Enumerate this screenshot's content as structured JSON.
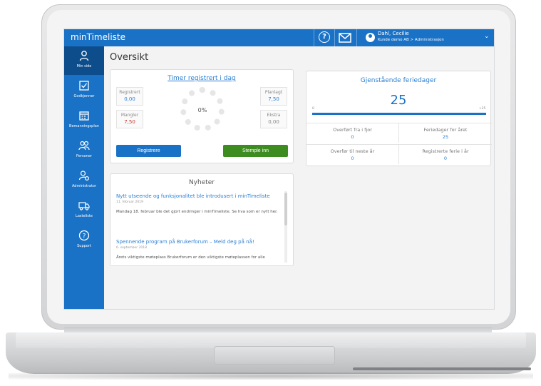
{
  "app": {
    "title": "minTimeliste"
  },
  "header": {
    "user_name": "Dahl, Cecilie",
    "user_org": "Kunde demo AB > Administrasjon",
    "icons": [
      "help-icon",
      "mail-icon",
      "user-icon",
      "chevron-down-icon"
    ]
  },
  "sidebar": {
    "items": [
      {
        "label": "Min side",
        "icon": "person-icon",
        "active": true
      },
      {
        "label": "Godkjenner",
        "icon": "checkbox-icon",
        "active": false
      },
      {
        "label": "Bemanningsplan",
        "icon": "calendar-icon",
        "active": false
      },
      {
        "label": "Personer",
        "icon": "people-icon",
        "active": false
      },
      {
        "label": "Administrator",
        "icon": "admin-icon",
        "active": false
      },
      {
        "label": "Lasteliste",
        "icon": "truck-icon",
        "active": false
      },
      {
        "label": "Support",
        "icon": "help-icon",
        "active": false
      }
    ]
  },
  "main": {
    "page_title": "Oversikt",
    "timer": {
      "title": "Timer registrert i dag",
      "registrert_label": "Registrert",
      "registrert_value": "0,00",
      "planlagt_label": "Planlagt",
      "planlagt_value": "7,50",
      "mangler_label": "Mangler",
      "mangler_value": "7,50",
      "ekstra_label": "Ekstra",
      "ekstra_value": "0,00",
      "percent": "0%",
      "register_button": "Registrere",
      "stamp_button": "Stemple inn"
    },
    "news": {
      "title": "Nyheter",
      "items": [
        {
          "title": "Nytt utseende og funksjonalitet ble introdusert i minTimeliste",
          "date": "11. februar 2019",
          "text": "Mandag 18. februar ble det gjort endringer i minTimeliste. Se hva som er nytt her."
        },
        {
          "title": "Spennende program på Brukerforum – Meld deg på nå!",
          "date": "6. september 2018",
          "text": "Årets viktigste møteplass Brukerforum er den viktigste møteplassen for alle"
        }
      ]
    },
    "vacation": {
      "title": "Gjenstående feriedager",
      "remaining": "25",
      "axis_min": "0",
      "axis_max": "+25",
      "overfort_label": "Overført fra i fjor",
      "overfort_value": "0",
      "feriedager_label": "Feriedager for året",
      "feriedager_value": "25",
      "overfor_label": "Overfør til neste år",
      "overfor_value": "0",
      "registrerte_label": "Registrerte ferie i år",
      "registrerte_value": "0"
    }
  },
  "colors": {
    "brand_blue": "#1a72c6",
    "active_nav": "#0e4d8c",
    "register_button": "#1a72c6",
    "stamp_button": "#3d8c1f",
    "red_value": "#c0392b"
  }
}
